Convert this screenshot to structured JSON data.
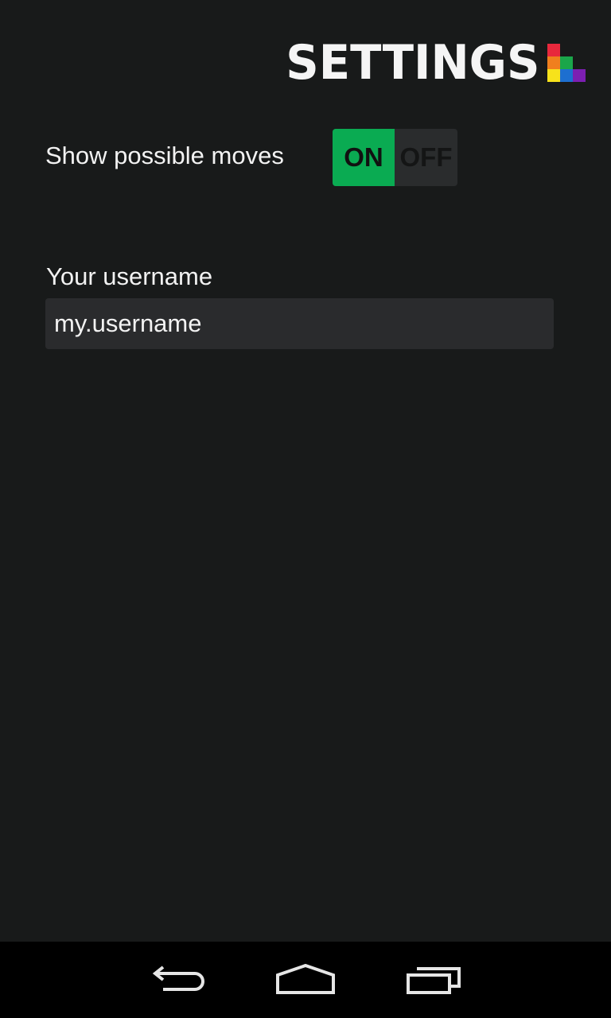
{
  "header": {
    "title": "SETTINGS",
    "logo_icon": "colored-blocks-logo",
    "logo_colors": {
      "red": "#e8283c",
      "orange": "#f07f1e",
      "green": "#1aa64a",
      "yellow": "#f7e21b",
      "blue": "#1d6fd0",
      "purple": "#7c1fb2"
    }
  },
  "settings": {
    "show_moves": {
      "label": "Show possible moves",
      "on_label": "ON",
      "off_label": "OFF",
      "state": "on",
      "on_color": "#0aab52"
    },
    "username": {
      "label": "Your username",
      "value": "my.username"
    }
  },
  "navbar": {
    "back_icon": "back-arrow-icon",
    "home_icon": "home-icon",
    "recents_icon": "recent-apps-icon"
  }
}
